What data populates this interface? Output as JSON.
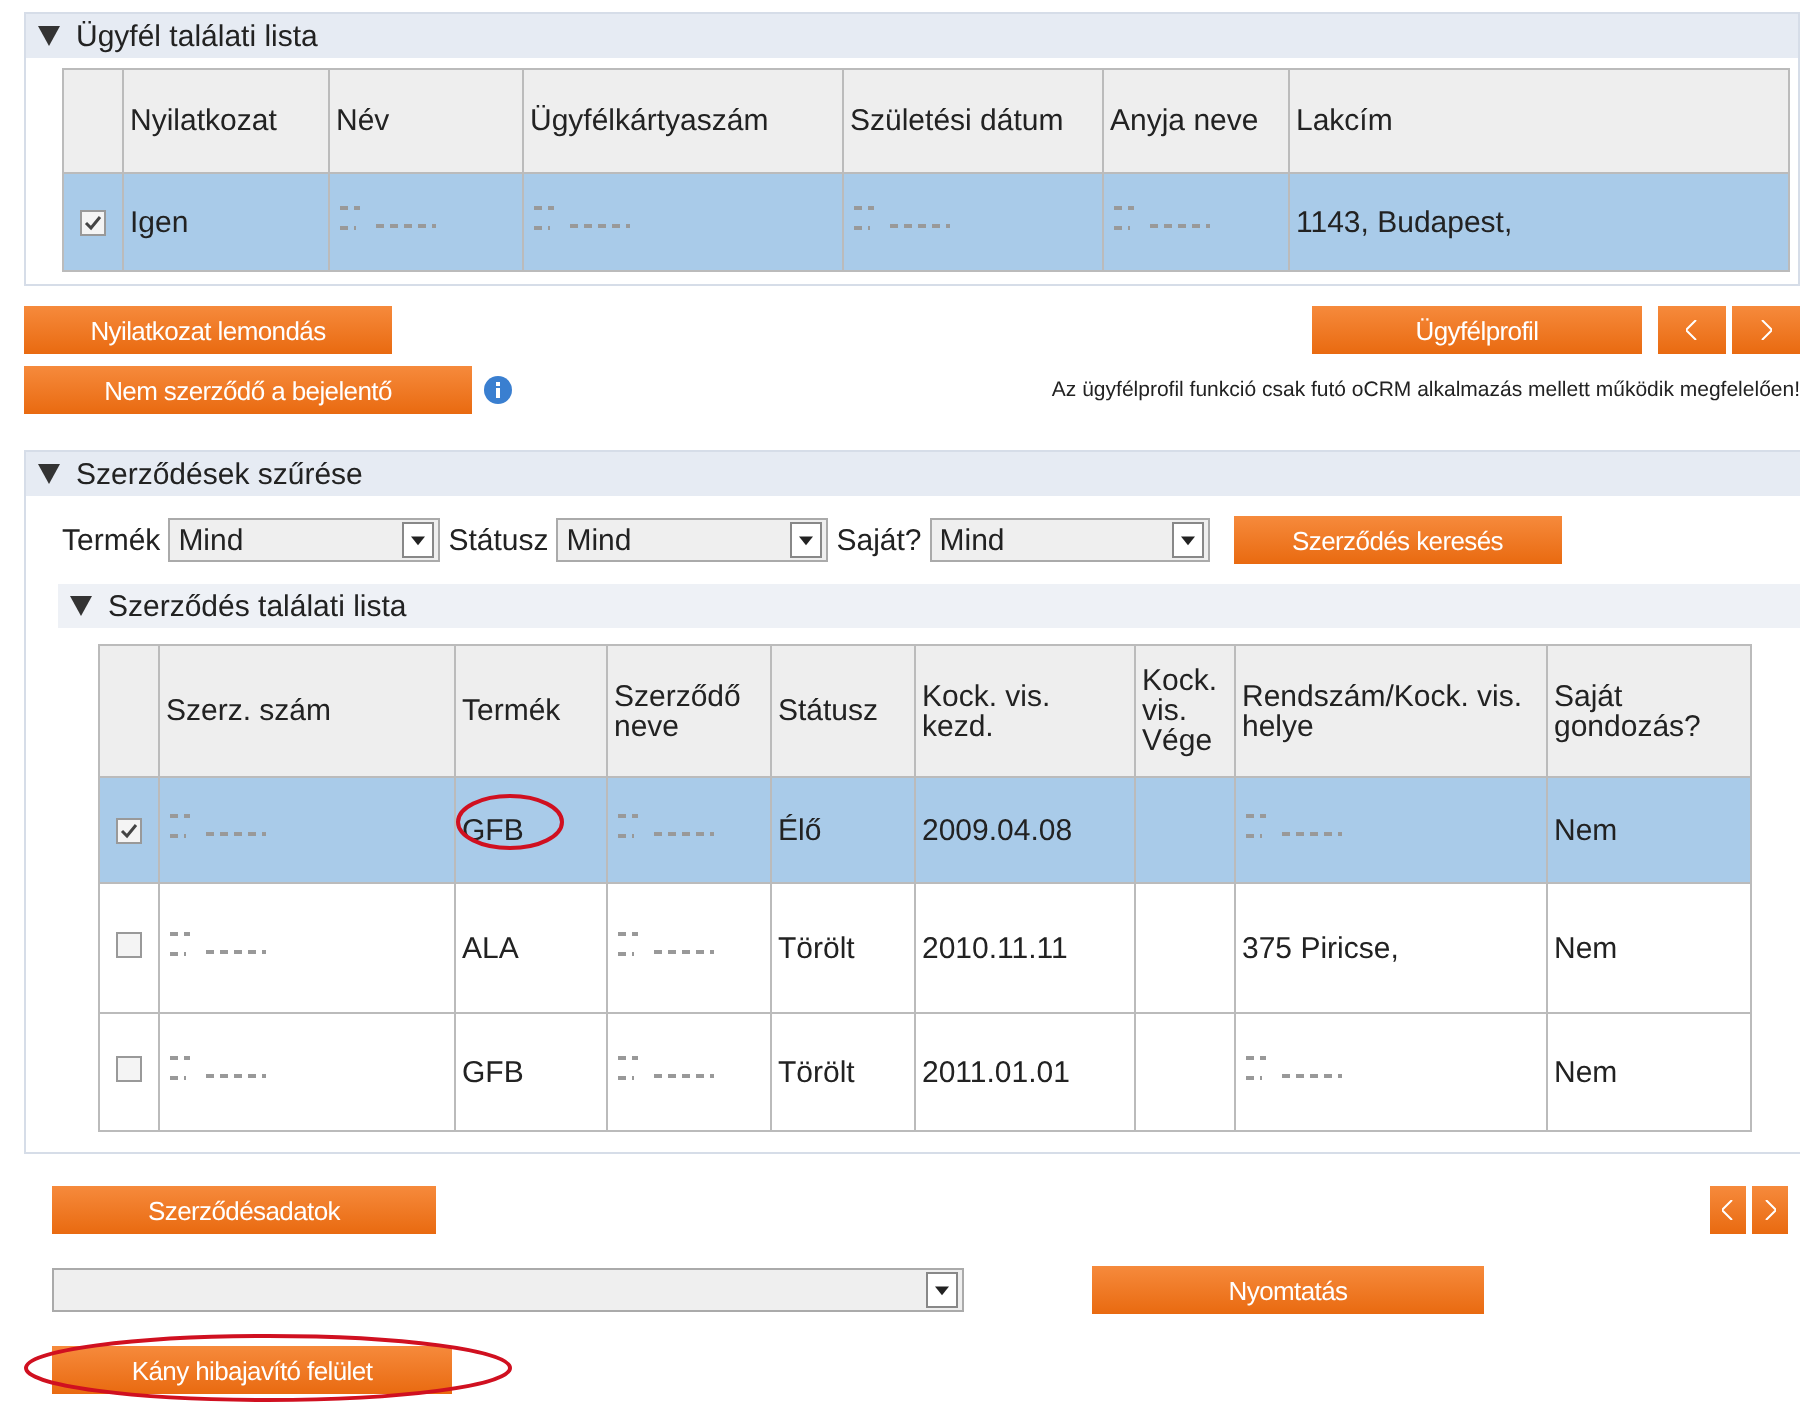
{
  "client_section": {
    "title": "Ügyfél találati lista",
    "expanded": true,
    "columns": [
      "",
      "Nyilatkozat",
      "Név",
      "Ügyfélkártyaszám",
      "Születési dátum",
      "Anyja neve",
      "Lakcím"
    ],
    "rows": [
      {
        "selected": true,
        "cells": [
          {
            "kind": "checkbox",
            "checked": true
          },
          {
            "kind": "text",
            "text": "Igen"
          },
          {
            "kind": "redacted"
          },
          {
            "kind": "redacted"
          },
          {
            "kind": "redacted"
          },
          {
            "kind": "redacted"
          },
          {
            "kind": "text",
            "text": "1143, Budapest,"
          }
        ]
      }
    ],
    "buttons_left": [
      "Nyilatkozat lemondás",
      "Nem szerződő a bejelentő"
    ],
    "profile_button": "Ügyfélprofil",
    "note": "Az ügyfélprofil funkció csak futó oCRM alkalmazás mellett működik megfelelően!"
  },
  "filter_section": {
    "title": "Szerződések szűrése",
    "expanded": true,
    "filters": [
      {
        "label": "Termék",
        "value": "Mind"
      },
      {
        "label": "Státusz",
        "value": "Mind"
      },
      {
        "label": "Saját?",
        "value": "Mind"
      }
    ],
    "search_button": "Szerződés keresés"
  },
  "contract_section": {
    "title": "Szerződés találati lista",
    "expanded": true,
    "columns": [
      "",
      "Szerz. szám",
      "Termék",
      "Szerződő neve",
      "Státusz",
      "Kock. vis. kezd.",
      "Kock. vis. Vége",
      "Rendszám/Kock. vis. helye",
      "Saját gondozás?"
    ],
    "rows": [
      {
        "selected": true,
        "cells": [
          {
            "kind": "checkbox",
            "checked": true
          },
          {
            "kind": "redacted"
          },
          {
            "kind": "text",
            "text": "GFB",
            "circled": true
          },
          {
            "kind": "redacted"
          },
          {
            "kind": "text",
            "text": "Élő"
          },
          {
            "kind": "text",
            "text": "2009.04.08"
          },
          {
            "kind": "text",
            "text": ""
          },
          {
            "kind": "redacted"
          },
          {
            "kind": "text",
            "text": "Nem"
          }
        ]
      },
      {
        "selected": false,
        "cells": [
          {
            "kind": "checkbox",
            "checked": false
          },
          {
            "kind": "redacted"
          },
          {
            "kind": "text",
            "text": "ALA"
          },
          {
            "kind": "redacted"
          },
          {
            "kind": "text",
            "text": "Törölt"
          },
          {
            "kind": "text",
            "text": "2010.11.11"
          },
          {
            "kind": "text",
            "text": ""
          },
          {
            "kind": "text",
            "text": "375 Piricse,"
          },
          {
            "kind": "text",
            "text": "Nem"
          }
        ]
      },
      {
        "selected": false,
        "cells": [
          {
            "kind": "checkbox",
            "checked": false
          },
          {
            "kind": "redacted"
          },
          {
            "kind": "text",
            "text": "GFB"
          },
          {
            "kind": "redacted"
          },
          {
            "kind": "text",
            "text": "Törölt"
          },
          {
            "kind": "text",
            "text": "2011.01.01"
          },
          {
            "kind": "text",
            "text": ""
          },
          {
            "kind": "redacted"
          },
          {
            "kind": "text",
            "text": "Nem"
          }
        ]
      }
    ],
    "details_button": "Szerződésadatok",
    "print_button": "Nyomtatás",
    "repair_button": {
      "label": "Kány hibajavító felület",
      "circled": true
    }
  }
}
